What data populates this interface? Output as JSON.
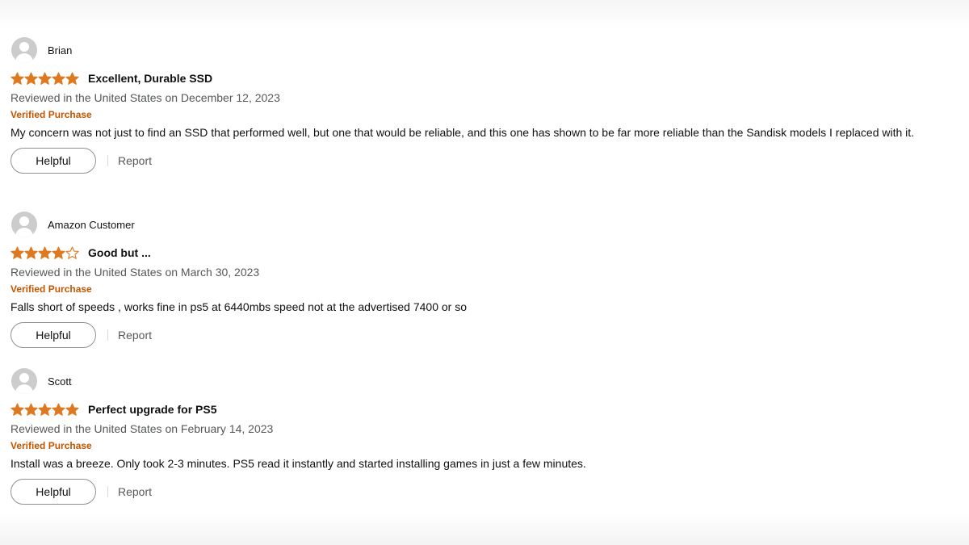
{
  "reviews": [
    {
      "author": "Brian",
      "rating": 5,
      "max_rating": 5,
      "title": "Excellent, Durable SSD",
      "meta": "Reviewed in the United States on December 12, 2023",
      "verified": "Verified Purchase",
      "body": "My concern was not just to find an SSD that performed well, but one that would be reliable, and this one has shown to be far more reliable than the Sandisk models I replaced with it.",
      "helpful_label": "Helpful",
      "report_label": "Report"
    },
    {
      "author": "Amazon Customer",
      "rating": 4,
      "max_rating": 5,
      "title": "Good but ...",
      "meta": "Reviewed in the United States on March 30, 2023",
      "verified": "Verified Purchase",
      "body": "Falls short of speeds , works fine in ps5 at 6440mbs speed not at the advertised 7400 or so",
      "helpful_label": "Helpful",
      "report_label": "Report"
    },
    {
      "author": "Scott",
      "rating": 5,
      "max_rating": 5,
      "title": "Perfect upgrade for PS5",
      "meta": "Reviewed in the United States on February 14, 2023",
      "verified": "Verified Purchase",
      "body": "Install was a breeze. Only took 2-3 minutes. PS5 read it instantly and started installing games in just a few minutes.",
      "helpful_label": "Helpful",
      "report_label": "Report"
    }
  ],
  "icons": {
    "avatar": "default-avatar-icon",
    "star_filled": "star-filled-icon",
    "star_empty": "star-empty-icon"
  },
  "colors": {
    "star": "#de7921",
    "verified": "#c45500",
    "meta_text": "#565959",
    "avatar_bg": "#cccccc"
  }
}
